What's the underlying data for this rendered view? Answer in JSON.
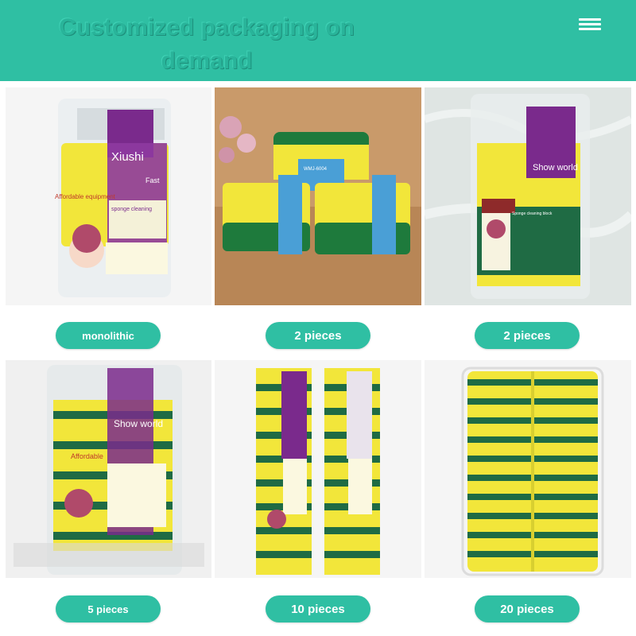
{
  "header": {
    "title": "Customized packaging on demand",
    "menu_icon": "hamburger-menu-icon"
  },
  "colors": {
    "accent": "#2fbfa3",
    "sponge_yellow": "#f2e63a",
    "scrub_green": "#1f7a4a",
    "package_purple": "#7a2a8c"
  },
  "products": [
    {
      "label": "monolithic",
      "package_brand": "Xiushi",
      "package_tag": "Affordable equipment",
      "package_sub": "sponge cleaning",
      "package_extra": "Fast"
    },
    {
      "label": "2 pieces",
      "package_code": "WMJ-6004"
    },
    {
      "label": "2 pieces",
      "package_brand": "Show world",
      "package_sub": "Sponge cleaning block"
    },
    {
      "label": "5 pieces",
      "package_brand": "Show world",
      "package_tag": "Affordable"
    },
    {
      "label": "10 pieces"
    },
    {
      "label": "20 pieces"
    }
  ]
}
